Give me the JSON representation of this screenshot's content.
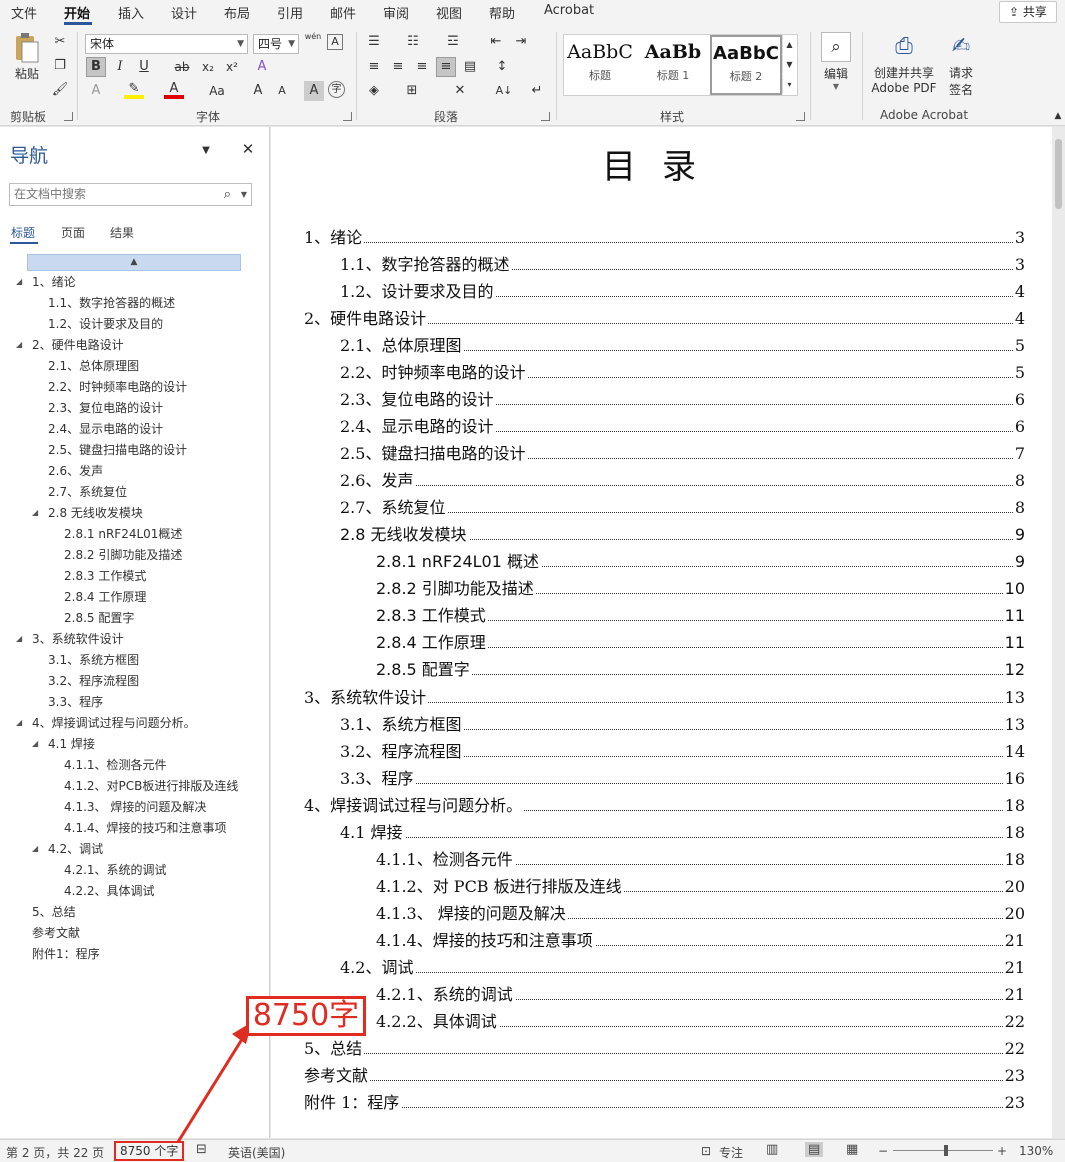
{
  "menu": {
    "items": [
      "文件",
      "开始",
      "插入",
      "设计",
      "布局",
      "引用",
      "邮件",
      "审阅",
      "视图",
      "帮助",
      "Acrobat"
    ],
    "share": "共享"
  },
  "ribbon": {
    "clipboard": {
      "paste": "粘贴",
      "group": "剪贴板"
    },
    "font": {
      "name": "宋体",
      "size": "四号",
      "group": "字体",
      "phonetic": "wén"
    },
    "paragraph": {
      "group": "段落"
    },
    "styles": {
      "group": "样式",
      "items": [
        {
          "sample": "AaBbC",
          "name": "标题"
        },
        {
          "sample": "AaBb",
          "name": "标题 1"
        },
        {
          "sample": "AaBbC",
          "name": "标题 2"
        }
      ]
    },
    "editing": {
      "label": "编辑"
    },
    "acrobat": {
      "create_share": "创建并共享",
      "adobe_pdf": "Adobe PDF",
      "request": "请求",
      "sign": "签名",
      "group": "Adobe Acrobat"
    }
  },
  "nav": {
    "title": "导航",
    "search_placeholder": "在文档中搜索",
    "tabs": [
      "标题",
      "页面",
      "结果"
    ],
    "items": [
      {
        "label": "1、绪论",
        "level": 1,
        "expanded": true
      },
      {
        "label": "1.1、数字抢答器的概述",
        "level": 2
      },
      {
        "label": "1.2、设计要求及目的",
        "level": 2
      },
      {
        "label": "2、硬件电路设计",
        "level": 1,
        "expanded": true
      },
      {
        "label": "2.1、总体原理图",
        "level": 2
      },
      {
        "label": "2.2、时钟频率电路的设计",
        "level": 2
      },
      {
        "label": "2.3、复位电路的设计",
        "level": 2
      },
      {
        "label": "2.4、显示电路的设计",
        "level": 2
      },
      {
        "label": "2.5、键盘扫描电路的设计",
        "level": 2
      },
      {
        "label": "2.6、发声",
        "level": 2
      },
      {
        "label": "2.7、系统复位",
        "level": 2
      },
      {
        "label": "2.8  无线收发模块",
        "level": 2,
        "expanded": true
      },
      {
        "label": "2.8.1  nRF24L01概述",
        "level": 3
      },
      {
        "label": "2.8.2  引脚功能及描述",
        "level": 3
      },
      {
        "label": "2.8.3  工作模式",
        "level": 3
      },
      {
        "label": "2.8.4  工作原理",
        "level": 3
      },
      {
        "label": "2.8.5  配置字",
        "level": 3
      },
      {
        "label": "3、系统软件设计",
        "level": 1,
        "expanded": true
      },
      {
        "label": "3.1、系统方框图",
        "level": 2
      },
      {
        "label": "3.2、程序流程图",
        "level": 2
      },
      {
        "label": "3.3、程序",
        "level": 2
      },
      {
        "label": "4、焊接调试过程与问题分析。",
        "level": 1,
        "expanded": true
      },
      {
        "label": "4.1 焊接",
        "level": 2,
        "expanded": true
      },
      {
        "label": "4.1.1、检测各元件",
        "level": 3
      },
      {
        "label": "4.1.2、对PCB板进行排版及连线",
        "level": 3
      },
      {
        "label": "4.1.3、 焊接的问题及解决",
        "level": 3
      },
      {
        "label": "4.1.4、焊接的技巧和注意事项",
        "level": 3
      },
      {
        "label": "4.2、调试",
        "level": 2,
        "expanded": true
      },
      {
        "label": "4.2.1、系统的调试",
        "level": 3
      },
      {
        "label": "4.2.2、具体调试",
        "level": 3
      },
      {
        "label": "5、总结",
        "level": 1
      },
      {
        "label": "参考文献",
        "level": 1
      },
      {
        "label": "附件1：程序",
        "level": 1
      }
    ]
  },
  "document": {
    "heading": "目录",
    "toc": [
      {
        "text": "1、绪论",
        "page": "3",
        "level": 1
      },
      {
        "text": "1.1、数字抢答器的概述",
        "page": "3",
        "level": 2
      },
      {
        "text": "1.2、设计要求及目的",
        "page": "4",
        "level": 2
      },
      {
        "text": "2、硬件电路设计",
        "page": "4",
        "level": 1
      },
      {
        "text": "2.1、总体原理图",
        "page": "5",
        "level": 2
      },
      {
        "text": "2.2、时钟频率电路的设计",
        "page": "5",
        "level": 2
      },
      {
        "text": "2.3、复位电路的设计",
        "page": "6",
        "level": 2
      },
      {
        "text": "2.4、显示电路的设计",
        "page": "6",
        "level": 2
      },
      {
        "text": "2.5、键盘扫描电路的设计",
        "page": "7",
        "level": 2
      },
      {
        "text": "2.6、发声",
        "page": "8",
        "level": 2
      },
      {
        "text": "2.7、系统复位",
        "page": "8",
        "level": 2
      },
      {
        "text": "2.8  无线收发模块",
        "page": "9",
        "level": 2,
        "sans": true
      },
      {
        "text": "2.8.1  nRF24L01 概述",
        "page": "9",
        "level": 3,
        "sans": true
      },
      {
        "text": "2.8.2  引脚功能及描述",
        "page": "10",
        "level": 3,
        "sans": true
      },
      {
        "text": "2.8.3  工作模式",
        "page": "11",
        "level": 3,
        "sans": true
      },
      {
        "text": "2.8.4  工作原理",
        "page": "11",
        "level": 3,
        "sans": true
      },
      {
        "text": "2.8.5  配置字",
        "page": "12",
        "level": 3,
        "sans": true
      },
      {
        "text": "3、系统软件设计",
        "page": "13",
        "level": 1
      },
      {
        "text": "3.1、系统方框图",
        "page": "13",
        "level": 2
      },
      {
        "text": "3.2、程序流程图",
        "page": "14",
        "level": 2
      },
      {
        "text": "3.3、程序",
        "page": "16",
        "level": 2
      },
      {
        "text": "4、焊接调试过程与问题分析。",
        "page": "18",
        "level": 1
      },
      {
        "text": "4.1 焊接",
        "page": "18",
        "level": 2
      },
      {
        "text": "4.1.1、检测各元件",
        "page": "18",
        "level": 3
      },
      {
        "text": "4.1.2、对 PCB 板进行排版及连线",
        "page": "20",
        "level": 3
      },
      {
        "text": "4.1.3、  焊接的问题及解决",
        "page": "20",
        "level": 3
      },
      {
        "text": "4.1.4、焊接的技巧和注意事项",
        "page": "21",
        "level": 3
      },
      {
        "text": "4.2、调试",
        "page": "21",
        "level": 2
      },
      {
        "text": "4.2.1、系统的调试",
        "page": "21",
        "level": 3
      },
      {
        "text": "4.2.2、具体调试",
        "page": "22",
        "level": 3
      },
      {
        "text": "5、总结",
        "page": "22",
        "level": 1
      },
      {
        "text": "参考文献",
        "page": "23",
        "level": 1
      },
      {
        "text": "附件 1：程序",
        "page": "23",
        "level": 1
      }
    ]
  },
  "status": {
    "page": "第 2 页，共 22 页",
    "word_count": "8750 个字",
    "language": "英语(美国)",
    "focus": "专注",
    "zoom": "130%"
  },
  "annotation": {
    "callout": "8750字",
    "color": "#e02b20"
  },
  "colors": {
    "accent": "#2b579a",
    "annotation": "#e02b20"
  }
}
